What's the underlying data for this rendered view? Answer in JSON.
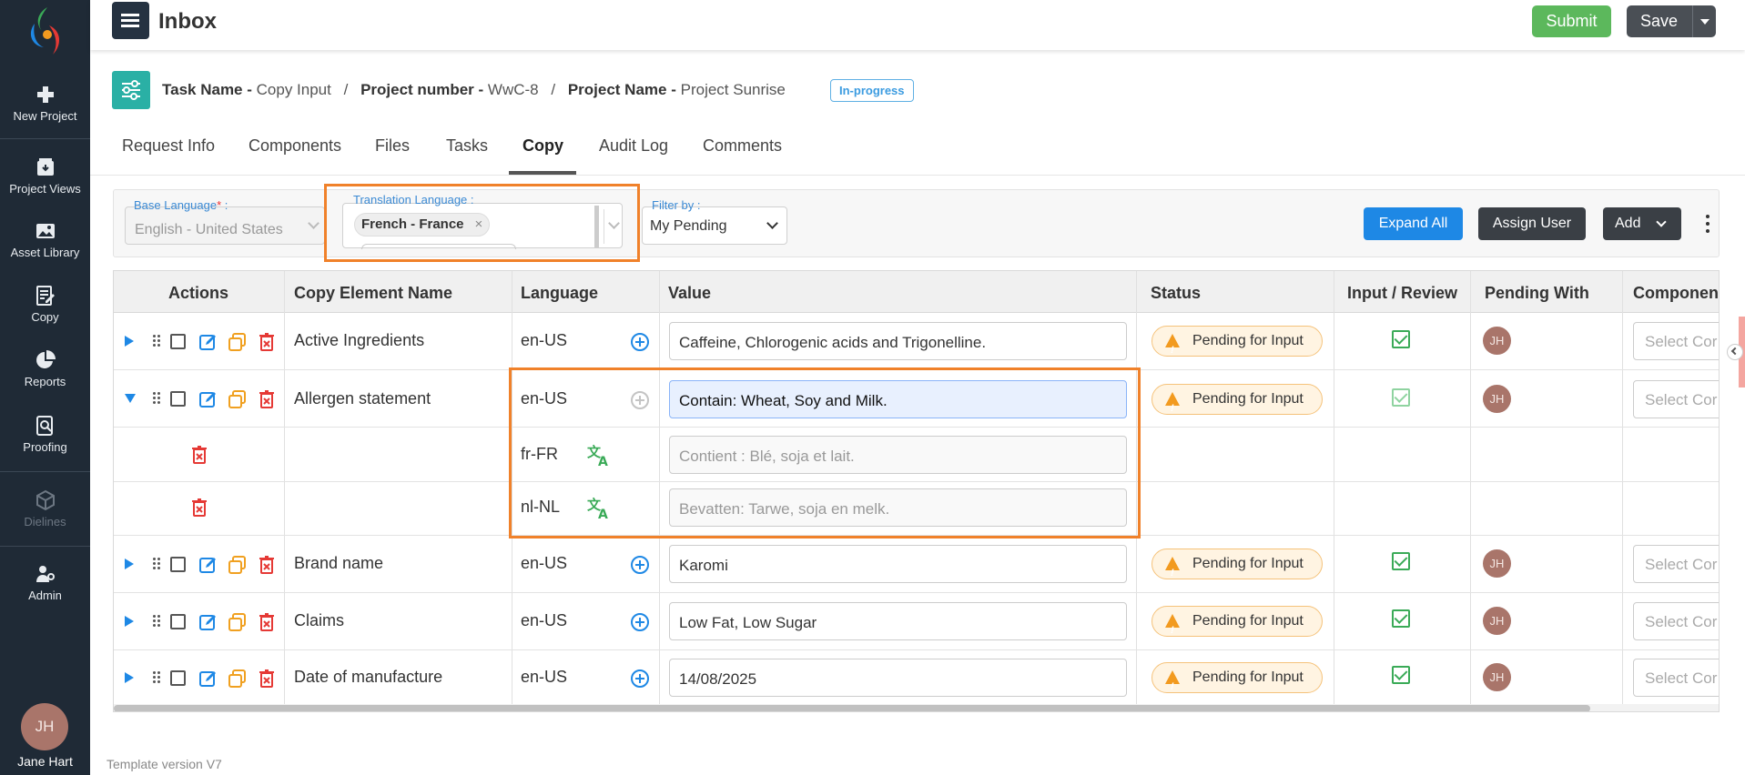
{
  "sidebar": {
    "items": [
      {
        "label": "New Project",
        "icon": "plus-icon"
      },
      {
        "label": "Project Views",
        "icon": "project-views-icon"
      },
      {
        "label": "Asset Library",
        "icon": "image-icon"
      },
      {
        "label": "Copy",
        "icon": "copy-edit-icon"
      },
      {
        "label": "Reports",
        "icon": "pie-chart-icon"
      },
      {
        "label": "Proofing",
        "icon": "proofing-search-icon"
      },
      {
        "label": "Dielines",
        "icon": "box-icon"
      },
      {
        "label": "Admin",
        "icon": "admin-user-icon"
      }
    ],
    "user": {
      "initials": "JH",
      "name": "Jane Hart"
    }
  },
  "header": {
    "title": "Inbox",
    "submit_label": "Submit",
    "save_label": "Save"
  },
  "task": {
    "task_name_label": "Task Name -",
    "task_name": "Copy Input",
    "project_number_label": "Project number -",
    "project_number": "WwC-8",
    "project_name_label": "Project Name -",
    "project_name": "Project Sunrise",
    "separator": "/",
    "status": "In-progress"
  },
  "tabs": [
    {
      "label": "Request Info",
      "active": false
    },
    {
      "label": "Components",
      "active": false
    },
    {
      "label": "Files",
      "active": false
    },
    {
      "label": "Tasks",
      "active": false
    },
    {
      "label": "Copy",
      "active": true
    },
    {
      "label": "Audit Log",
      "active": false
    },
    {
      "label": "Comments",
      "active": false
    }
  ],
  "filters": {
    "base_language_label": "Base Language",
    "base_language_colon": ":",
    "base_language_value": "English - United States",
    "translation_language_label": "Translation Language :",
    "translation_chip": "French - France",
    "chip_remove": "×",
    "filter_by_label": "Filter by :",
    "filter_by_value": "My Pending",
    "expand_all_label": "Expand All",
    "assign_user_label": "Assign User",
    "add_label": "Add"
  },
  "table": {
    "columns": [
      "Actions",
      "Copy Element Name",
      "Language",
      "Value",
      "Status",
      "Input / Review",
      "Pending With",
      "Componen"
    ],
    "rows": [
      {
        "name": "Active Ingredients",
        "language": "en-US",
        "value": "Caffeine, Chlorogenic acids and Trigonelline.",
        "status": "Pending for Input",
        "pending_with": "JH",
        "component": "Select Cor",
        "expanded": false
      },
      {
        "name": "Allergen statement",
        "language": "en-US",
        "value": "Contain: Wheat, Soy and Milk.",
        "status": "Pending for Input",
        "pending_with": "JH",
        "component": "Select Cor",
        "expanded": true
      },
      {
        "name": "",
        "language": "fr-FR",
        "value": "Contient : Blé, soja et lait.",
        "translation": true
      },
      {
        "name": "",
        "language": "nl-NL",
        "value": "Bevatten: Tarwe, soja en melk.",
        "translation": true
      },
      {
        "name": "Brand name",
        "language": "en-US",
        "value": "Karomi",
        "status": "Pending for Input",
        "pending_with": "JH",
        "component": "Select Cor",
        "expanded": false
      },
      {
        "name": "Claims",
        "language": "en-US",
        "value": "Low Fat, Low Sugar",
        "status": "Pending for Input",
        "pending_with": "JH",
        "component": "Select Cor",
        "expanded": false
      },
      {
        "name": "Date of manufacture",
        "language": "en-US",
        "value": "14/08/2025",
        "status": "Pending for Input",
        "pending_with": "JH",
        "component": "Select Cor",
        "expanded": false
      }
    ]
  },
  "footer": {
    "template_version": "Template version V7"
  },
  "colors": {
    "sidebar": "#1f2a36",
    "accent_blue": "#1e88e5",
    "highlight_orange": "#f0812a",
    "submit_green": "#5cb85c",
    "status_warn": "#f29a1f"
  }
}
